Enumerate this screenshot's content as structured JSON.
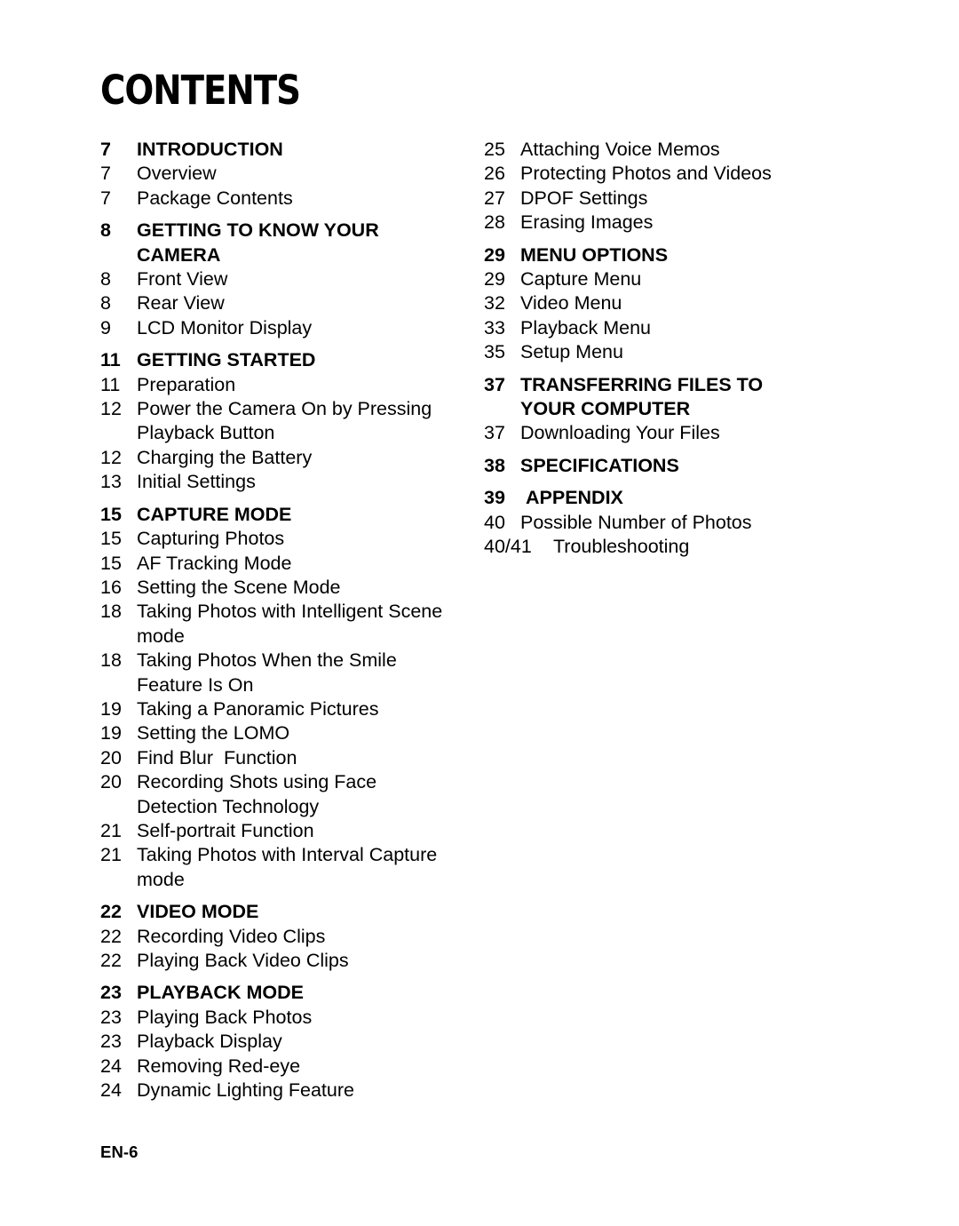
{
  "page": {
    "title": "CONTENTS",
    "footer_label": "EN-6"
  },
  "left_column": [
    {
      "kind": "section",
      "page": "7",
      "label": "INTRODUCTION"
    },
    {
      "kind": "item",
      "page": "7",
      "label": "Overview"
    },
    {
      "kind": "item",
      "page": "7",
      "label": "Package Contents"
    },
    {
      "kind": "section",
      "page": "8",
      "label": "GETTING TO KNOW YOUR\nCAMERA"
    },
    {
      "kind": "item",
      "page": "8",
      "label": "Front View"
    },
    {
      "kind": "item",
      "page": "8",
      "label": "Rear View"
    },
    {
      "kind": "item",
      "page": "9",
      "label": "LCD Monitor Display"
    },
    {
      "kind": "section",
      "page": "11",
      "label": "GETTING STARTED"
    },
    {
      "kind": "item",
      "page": "11",
      "label": "Preparation"
    },
    {
      "kind": "item",
      "page": "12",
      "label": "Power the Camera On by Pressing\nPlayback Button"
    },
    {
      "kind": "item",
      "page": "12",
      "label": "Charging the Battery"
    },
    {
      "kind": "item",
      "page": "13",
      "label": "Initial Settings"
    },
    {
      "kind": "section",
      "page": "15",
      "label": "CAPTURE MODE"
    },
    {
      "kind": "item",
      "page": "15",
      "label": "Capturing Photos"
    },
    {
      "kind": "item",
      "page": "15",
      "label": "AF Tracking Mode"
    },
    {
      "kind": "item",
      "page": "16",
      "label": "Setting the Scene Mode"
    },
    {
      "kind": "item",
      "page": "18",
      "label": "Taking Photos with Intelligent Scene\nmode"
    },
    {
      "kind": "item",
      "page": "18",
      "label": "Taking Photos When the Smile\nFeature Is On"
    },
    {
      "kind": "item",
      "page": "19",
      "label": "Taking a Panoramic Pictures"
    },
    {
      "kind": "item",
      "page": "19",
      "label": "Setting the LOMO"
    },
    {
      "kind": "item",
      "page": "20",
      "label": "Find Blur  Function"
    },
    {
      "kind": "item",
      "page": "20",
      "label": "Recording Shots using Face\nDetection Technology"
    },
    {
      "kind": "item",
      "page": "21",
      "label": "Self-portrait Function"
    },
    {
      "kind": "item",
      "page": "21",
      "label": "Taking Photos with Interval Capture\nmode"
    },
    {
      "kind": "section",
      "page": "22",
      "label": "VIDEO MODE"
    },
    {
      "kind": "item",
      "page": "22",
      "label": "Recording Video Clips"
    },
    {
      "kind": "item",
      "page": "22",
      "label": "Playing Back Video Clips"
    },
    {
      "kind": "section",
      "page": "23",
      "label": "PLAYBACK MODE"
    },
    {
      "kind": "item",
      "page": "23",
      "label": "Playing Back Photos"
    },
    {
      "kind": "item",
      "page": "23",
      "label": "Playback Display"
    },
    {
      "kind": "item",
      "page": "24",
      "label": "Removing Red-eye"
    },
    {
      "kind": "item",
      "page": "24",
      "label": "Dynamic Lighting Feature"
    }
  ],
  "right_column": [
    {
      "kind": "item",
      "page": "25",
      "label": "Attaching Voice Memos"
    },
    {
      "kind": "item",
      "page": "26",
      "label": "Protecting Photos and Videos"
    },
    {
      "kind": "item",
      "page": "27",
      "label": "DPOF Settings"
    },
    {
      "kind": "item",
      "page": "28",
      "label": "Erasing Images"
    },
    {
      "kind": "section",
      "page": "29",
      "label": "MENU OPTIONS"
    },
    {
      "kind": "item",
      "page": "29",
      "label": "Capture Menu"
    },
    {
      "kind": "item",
      "page": "32",
      "label": "Video Menu"
    },
    {
      "kind": "item",
      "page": "33",
      "label": "Playback Menu"
    },
    {
      "kind": "item",
      "page": "35",
      "label": "Setup Menu"
    },
    {
      "kind": "section",
      "page": "37",
      "label": "TRANSFERRING FILES TO\nYOUR COMPUTER"
    },
    {
      "kind": "item",
      "page": "37",
      "label": "Downloading Your Files"
    },
    {
      "kind": "section",
      "page": "38",
      "label": "SPECIFICATIONS"
    },
    {
      "kind": "section",
      "page": "39",
      "label": " APPENDIX"
    },
    {
      "kind": "item",
      "page": "40",
      "label": "Possible Number of Photos"
    },
    {
      "kind": "item",
      "page": "40/41",
      "label": "  Troubleshooting"
    }
  ]
}
